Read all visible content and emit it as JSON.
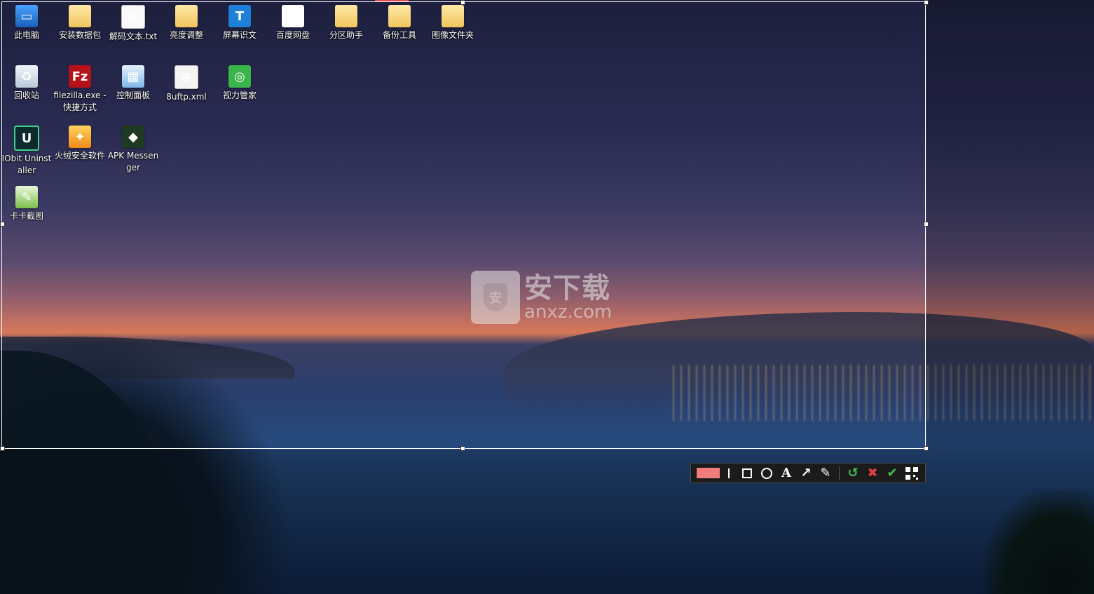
{
  "desktop": {
    "icons": [
      {
        "label": "此电脑",
        "glyph": "▭",
        "icon": "computer-icon"
      },
      {
        "label": "安装数据包",
        "glyph": "",
        "icon": "folder-icon"
      },
      {
        "label": "解码文本.txt",
        "glyph": "≡",
        "icon": "text-file-icon"
      },
      {
        "label": "亮度调整",
        "glyph": "",
        "icon": "folder-icon"
      },
      {
        "label": "屏幕识文",
        "glyph": "T",
        "icon": "ocr-app-icon"
      },
      {
        "label": "百度网盘",
        "glyph": "☁",
        "icon": "cloud-drive-icon"
      },
      {
        "label": "分区助手",
        "glyph": "",
        "icon": "folder-icon"
      },
      {
        "label": "备份工具",
        "glyph": "",
        "icon": "folder-icon"
      },
      {
        "label": "图像文件夹",
        "glyph": "",
        "icon": "folder-icon"
      },
      {
        "label": "回收站",
        "glyph": "♻",
        "icon": "recycle-bin-icon"
      },
      {
        "label": "filezilla.exe - 快捷方式",
        "glyph": "Fz",
        "icon": "filezilla-icon"
      },
      {
        "label": "控制面板",
        "glyph": "▦",
        "icon": "control-panel-icon"
      },
      {
        "label": "8uftp.xml",
        "glyph": "⊕",
        "icon": "xml-file-icon"
      },
      {
        "label": "视力管家",
        "glyph": "◎",
        "icon": "eye-care-icon"
      },
      {
        "label": "IObit Uninstaller",
        "glyph": "U",
        "icon": "iobit-icon"
      },
      {
        "label": "火绒安全软件",
        "glyph": "✦",
        "icon": "huorong-icon"
      },
      {
        "label": "APK Messenger",
        "glyph": "◆",
        "icon": "apk-messenger-icon"
      },
      {
        "label": "卡卡截图",
        "glyph": "✎",
        "icon": "kaka-screenshot-icon"
      }
    ]
  },
  "watermark": {
    "cn": "安下载",
    "en": "anxz.com",
    "badge": "安"
  },
  "toolbar": {
    "color_swatch": "#f07c7c",
    "text_glyph": "A",
    "arrow_glyph": "↗",
    "brush_glyph": "✎",
    "undo_glyph": "↺",
    "cancel_glyph": "✖",
    "confirm_glyph": "✔"
  }
}
